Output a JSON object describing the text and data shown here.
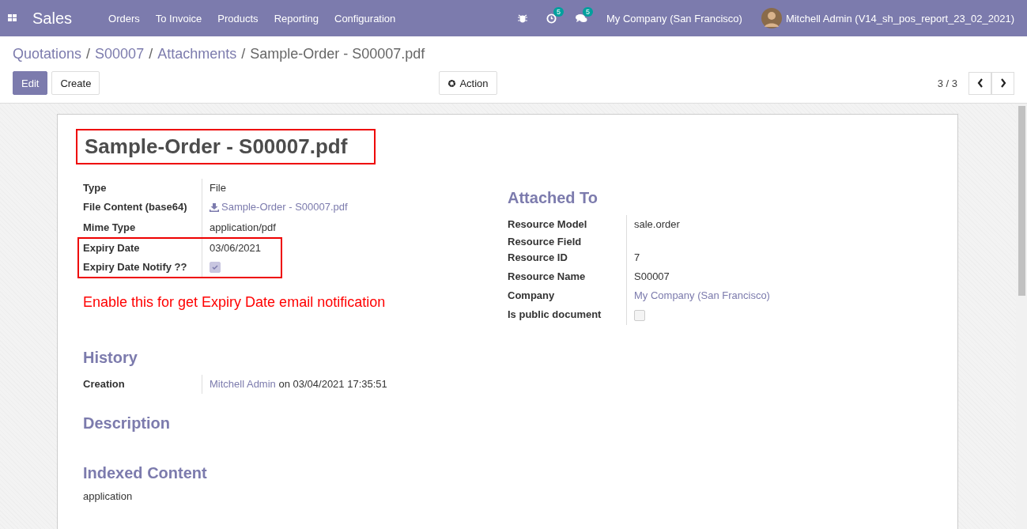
{
  "navbar": {
    "app": "Sales",
    "menu": [
      "Orders",
      "To Invoice",
      "Products",
      "Reporting",
      "Configuration"
    ],
    "activity_count": "5",
    "message_count": "5",
    "company": "My Company (San Francisco)",
    "user": "Mitchell Admin (V14_sh_pos_report_23_02_2021)"
  },
  "breadcrumbs": [
    {
      "label": "Quotations",
      "link": true
    },
    {
      "separator": "/",
      "label": "S00007",
      "link": true
    },
    {
      "separator": "/",
      "label": "Attachments",
      "link": true
    },
    {
      "separator": "/",
      "label": "Sample-Order - S00007.pdf",
      "link": false
    }
  ],
  "buttons": [
    {
      "label": "Edit",
      "primary": true
    },
    {
      "label": "Create",
      "primary": false
    }
  ],
  "action": "Action",
  "pager": "3 / 3",
  "sheet": {
    "title": {
      "text": "Sample-Order - S00007.pdf",
      "highlighted": true
    },
    "fields": [
      {
        "label": "Type",
        "kind": "text",
        "value": "File"
      },
      {
        "label": "File Content (base64)",
        "kind": "file",
        "value": "Sample-Order - S00007.pdf"
      },
      {
        "label": "Mime Type",
        "kind": "text",
        "value": "application/pdf"
      }
    ],
    "highlighted_fields": [
      {
        "label": "Expiry Date",
        "kind": "text",
        "value": "03/06/2021"
      },
      {
        "label": "Expiry Date Notify ??",
        "kind": "checkbox",
        "checked": true
      }
    ],
    "annotation": "Enable this for get Expiry Date email notification",
    "attached_to": {
      "title": "Attached To",
      "fields": [
        {
          "label": "Resource Model",
          "kind": "text",
          "value": "sale.order"
        },
        {
          "label": "Resource Field",
          "kind": "empty"
        },
        {
          "label": "Resource ID",
          "kind": "text",
          "value": "7"
        },
        {
          "label": "Resource Name",
          "kind": "text",
          "value": "S00007"
        },
        {
          "label": "Company",
          "kind": "link",
          "value": "My Company (San Francisco)"
        },
        {
          "label": "Is public document",
          "kind": "checkbox",
          "checked": false
        }
      ]
    },
    "history": {
      "title": "History",
      "label": "Creation",
      "author": "Mitchell Admin",
      "rest": "on 03/04/2021 17:35:51"
    },
    "description": {
      "title": "Description"
    },
    "indexed_content": {
      "title": "Indexed Content",
      "text": "application"
    }
  }
}
